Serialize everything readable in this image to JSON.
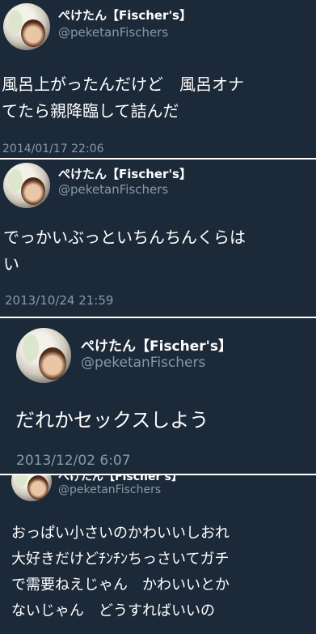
{
  "tweets": [
    {
      "user": {
        "name": "ぺけたん【Fischer's】",
        "handle": "@peketanFischers"
      },
      "text": "風呂上がったんだけど　風呂オナ\nてたら親降臨して詰んだ",
      "timestamp": "2014/01/17 22:06"
    },
    {
      "user": {
        "name": "ぺけたん【Fischer's】",
        "handle": "@peketanFischers"
      },
      "text": "でっかいぶっといちんちんくらは\nい",
      "timestamp": "2013/10/24 21:59"
    },
    {
      "user": {
        "name": "ぺけたん【Fischer's】",
        "handle": "@peketanFischers"
      },
      "text": "だれかセックスしよう",
      "timestamp": "2013/12/02 6:07"
    },
    {
      "user": {
        "name": "ぺけたん【Fischer's】",
        "handle": "@peketanFischers"
      },
      "text": "おっぱい小さいのかわいいしおれ\n大好きだけどﾁﾝﾁﾝちっさいてガチ\nで需要ねえじゃん　かわいいとか\nないじゃん　どうすればいいの",
      "timestamp": ""
    }
  ],
  "colors": {
    "card_bg": "#1c2938",
    "text": "#ffffff",
    "muted": "#8899a6"
  }
}
